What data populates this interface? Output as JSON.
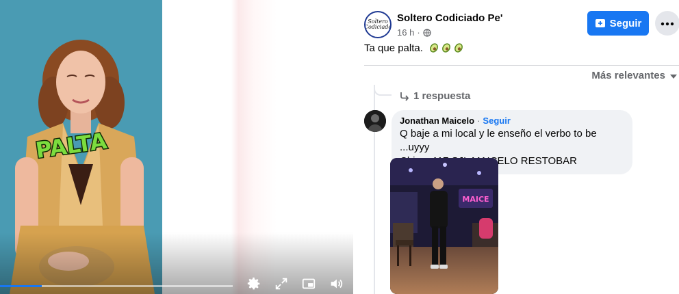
{
  "video": {
    "overlay_word": "PALTA",
    "progress_fraction": 0.18,
    "controls": [
      {
        "name": "settings-icon"
      },
      {
        "name": "fullscreen-icon"
      },
      {
        "name": "pip-icon"
      },
      {
        "name": "volume-icon"
      }
    ]
  },
  "post": {
    "page_name": "Soltero Codiciado Pe'",
    "avatar_text": "Soltero Codiciado",
    "time": "16 h",
    "meta_separator": "·",
    "text": "Ta que palta.",
    "emoji_count": 3,
    "follow_label": "Seguir",
    "sort_label": "Más relevantes"
  },
  "thread": {
    "replies_label": "1 respuesta"
  },
  "comment": {
    "author": "Jonathan Maicelo",
    "separator": "·",
    "follow_label": "Seguir",
    "text_line1": "Q baje a mi local y le enseño el verbo to be ...uyyy",
    "text_line2": "Chimu 117 SJL MAICELO RESTOBAR"
  },
  "colors": {
    "accent": "#1877f2",
    "video_bg": "#4a9bb3",
    "bubble": "#f0f2f5",
    "muted_text": "#65676b"
  }
}
